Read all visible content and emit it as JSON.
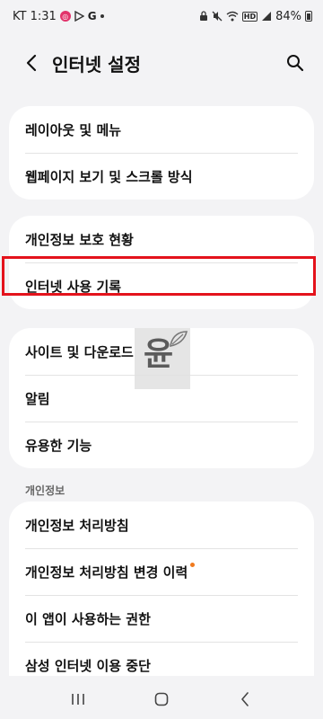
{
  "status_bar": {
    "time": "KT 1:31",
    "battery": "84%",
    "left_icons": [
      "instagram-icon",
      "play-store-icon",
      "google-icon",
      "more-dot-icon"
    ],
    "right_icons": [
      "lock-icon",
      "mute-icon",
      "wifi-icon",
      "hd-icon",
      "signal-icon",
      "battery-icon"
    ]
  },
  "header": {
    "title": "인터넷 설정",
    "back_icon": "back-chevron-icon",
    "search_icon": "search-icon"
  },
  "groups": [
    {
      "items": [
        {
          "label": "레이아웃 및 메뉴"
        },
        {
          "label": "웹페이지 보기 및 스크롤 방식"
        }
      ]
    },
    {
      "items": [
        {
          "label": "개인정보 보호 현황"
        },
        {
          "label": "인터넷 사용 기록"
        }
      ]
    },
    {
      "items": [
        {
          "label": "사이트 및 다운로드"
        },
        {
          "label": "알림"
        },
        {
          "label": "유용한 기능"
        }
      ]
    },
    {
      "section": "개인정보",
      "items": [
        {
          "label": "개인정보 처리방침"
        },
        {
          "label": "개인정보 처리방침 변경 이력",
          "new_badge": true
        },
        {
          "label": "이 앱이 사용하는 권한"
        },
        {
          "label": "삼성 인터넷 이용 중단"
        }
      ]
    }
  ],
  "highlight": {
    "target": "인터넷 사용 기록",
    "color": "#e4131c"
  },
  "watermark": {
    "char": "윤"
  },
  "nav_bar": {
    "buttons": [
      "recents-icon",
      "home-icon",
      "back-icon"
    ]
  },
  "colors": {
    "background": "#f3f3f5",
    "card": "#ffffff",
    "badge": "#f07a1e"
  }
}
